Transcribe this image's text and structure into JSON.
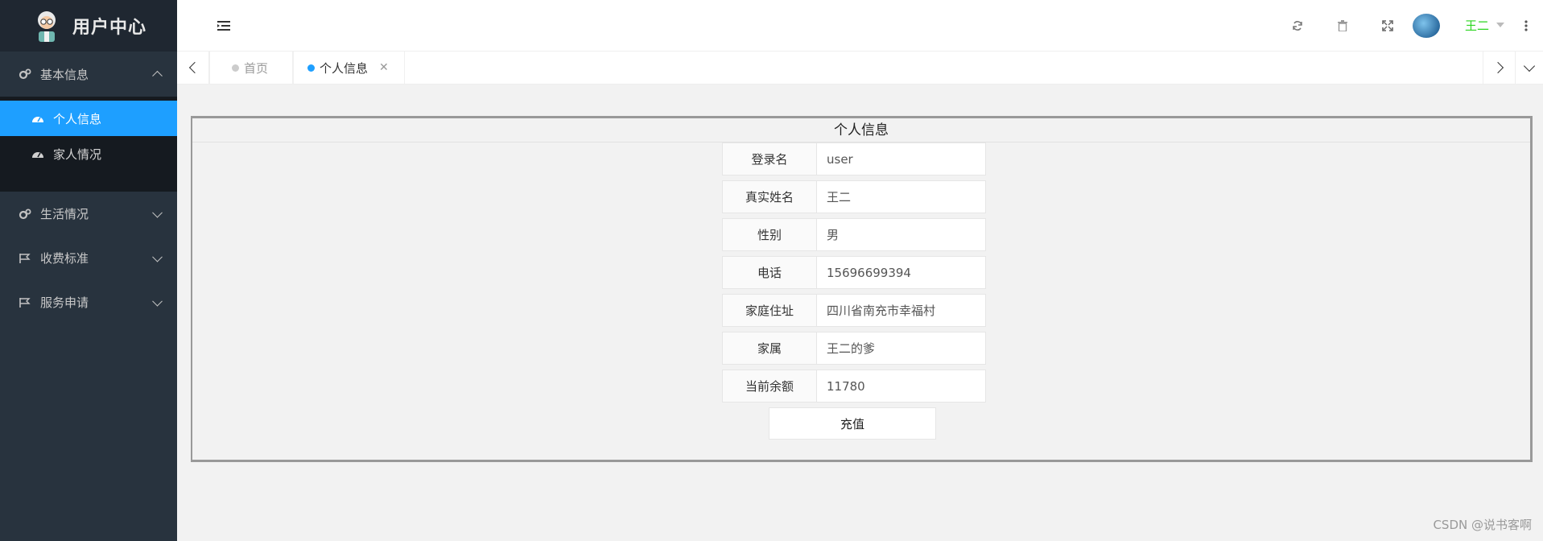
{
  "brand": {
    "title": "用户中心",
    "logo": "doctor-avatar-logo"
  },
  "sidebar": {
    "groups": [
      {
        "label": "基本信息",
        "icon": "gears-icon",
        "expanded": true,
        "items": [
          {
            "label": "个人信息",
            "icon": "dashboard-icon",
            "active": true
          },
          {
            "label": "家人情况",
            "icon": "dashboard-icon",
            "active": false
          }
        ]
      },
      {
        "label": "生活情况",
        "icon": "gears-icon",
        "expanded": false
      },
      {
        "label": "收费标准",
        "icon": "flag-icon",
        "expanded": false
      },
      {
        "label": "服务申请",
        "icon": "flag-icon",
        "expanded": false
      }
    ]
  },
  "header": {
    "icons": [
      "menu-toggle-icon",
      "refresh-icon",
      "trash-icon",
      "fullscreen-icon",
      "more-vertical-icon"
    ],
    "user": {
      "name": "王二",
      "name_color": "#2bd51f"
    }
  },
  "tabs": [
    {
      "label": "首页",
      "active": false,
      "dot_color": "#cccccc"
    },
    {
      "label": "个人信息",
      "active": true,
      "dot_color": "#1e9fff",
      "closable": true
    }
  ],
  "panel": {
    "title": "个人信息",
    "fields": [
      {
        "label": "登录名",
        "value": "user"
      },
      {
        "label": "真实姓名",
        "value": "王二"
      },
      {
        "label": "性别",
        "value": "男"
      },
      {
        "label": "电话",
        "value": "15696699394"
      },
      {
        "label": "家庭住址",
        "value": "四川省南充市幸福村"
      },
      {
        "label": "家属",
        "value": "王二的爹"
      },
      {
        "label": "当前余额",
        "value": "11780"
      }
    ],
    "button_label": "充值"
  },
  "watermark": "CSDN @说书客啊",
  "colors": {
    "sidebar_bg": "#28333e",
    "accent": "#1e9fff",
    "submenu_bg": "#151a20"
  }
}
